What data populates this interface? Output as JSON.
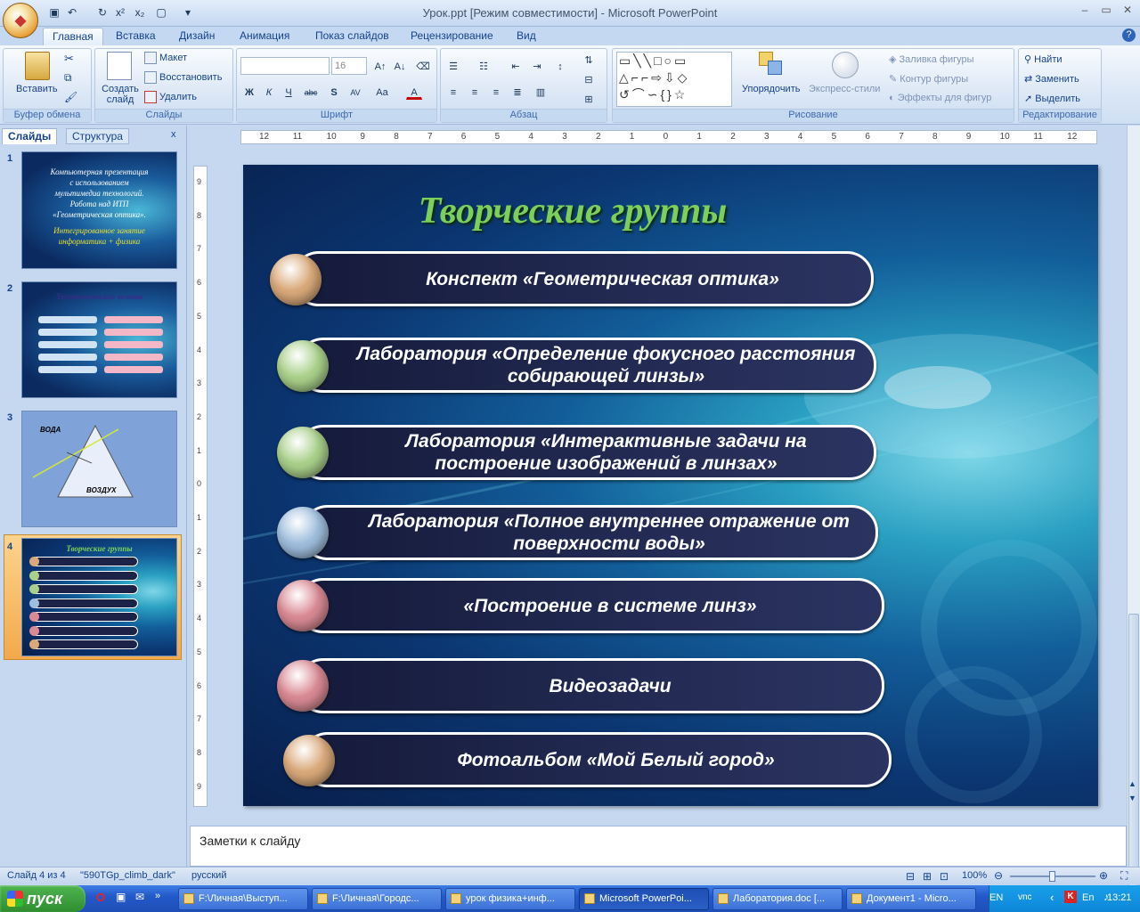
{
  "window": {
    "title": "Урок.ppt [Режим совместимости] - Microsoft PowerPoint"
  },
  "ribbon": {
    "tabs": [
      "Главная",
      "Вставка",
      "Дизайн",
      "Анимация",
      "Показ слайдов",
      "Рецензирование",
      "Вид"
    ],
    "groups": {
      "clipboard": {
        "label": "Буфер обмена",
        "paste": "Вставить"
      },
      "slides": {
        "label": "Слайды",
        "new_slide": "Создать слайд",
        "layout": "Макет",
        "reset": "Восстановить",
        "delete": "Удалить"
      },
      "font": {
        "label": "Шрифт",
        "font_size": "16"
      },
      "paragraph": {
        "label": "Абзац"
      },
      "drawing": {
        "label": "Рисование",
        "arrange": "Упорядочить",
        "quick_styles": "Экспресс-стили",
        "fill": "Заливка фигуры",
        "outline": "Контур фигуры",
        "effects": "Эффекты для фигур"
      },
      "editing": {
        "label": "Редактирование",
        "find": "Найти",
        "replace": "Заменить",
        "select": "Выделить"
      }
    }
  },
  "left_pane": {
    "tabs": [
      "Слайды",
      "Структура"
    ],
    "thumbnails": [
      {
        "number": "1",
        "lines": [
          "Компьютерная презентация",
          "с использованием",
          "мультимедиа технологий.",
          "Работа над ИТП",
          "«Геометрическая оптика».",
          "Интегрированное занятие",
          "информатика + физика"
        ]
      },
      {
        "number": "2",
        "title": "Технологические основы"
      },
      {
        "number": "3",
        "label_top": "ВОДА",
        "label_bottom": "ВОЗДУХ"
      },
      {
        "number": "4",
        "title": "Творческие группы"
      }
    ]
  },
  "slide": {
    "title": "Творческие группы",
    "items": [
      {
        "text": "Конспект «Геометрическая оптика»",
        "ball_color": "#d9a97a"
      },
      {
        "text": "Лаборатория «Определение фокусного расстояния собирающей линзы»",
        "ball_color": "#a9d08a"
      },
      {
        "text": "Лаборатория «Интерактивные задачи на построение изображений в линзах»",
        "ball_color": "#a9d08a"
      },
      {
        "text": "Лаборатория «Полное внутреннее отражение от поверхности воды»",
        "ball_color": "#9fbedd"
      },
      {
        "text": "«Построение в системе линз»",
        "ball_color": "#d98a94"
      },
      {
        "text": "Видеозадачи",
        "ball_color": "#d98a94"
      },
      {
        "text": "Фотоальбом «Мой Белый город»",
        "ball_color": "#d9a97a"
      }
    ]
  },
  "notes": {
    "placeholder": "Заметки к слайду"
  },
  "status": {
    "slide": "Слайд 4 из 4",
    "theme": "\"590TGp_climb_dark\"",
    "language": "русский",
    "zoom": "100%"
  },
  "taskbar": {
    "start": "пуск",
    "tasks": [
      "F:\\Личная\\Выступ...",
      "F:\\Личная\\Городс...",
      "урок физика+инф...",
      "Microsoft PowerPoi...",
      "Лаборатория.doc [...",
      "Документ1 - Micro..."
    ],
    "lang": "EN",
    "time": "13:21"
  },
  "ruler": {
    "h_ticks": [
      "12",
      "11",
      "10",
      "9",
      "8",
      "7",
      "6",
      "5",
      "4",
      "3",
      "2",
      "1",
      "0",
      "1",
      "2",
      "3",
      "4",
      "5",
      "6",
      "7",
      "8",
      "9",
      "10",
      "11",
      "12"
    ],
    "v_ticks": [
      "9",
      "8",
      "7",
      "6",
      "5",
      "4",
      "3",
      "2",
      "1",
      "0",
      "1",
      "2",
      "3",
      "4",
      "5",
      "6",
      "7",
      "8",
      "9"
    ]
  }
}
